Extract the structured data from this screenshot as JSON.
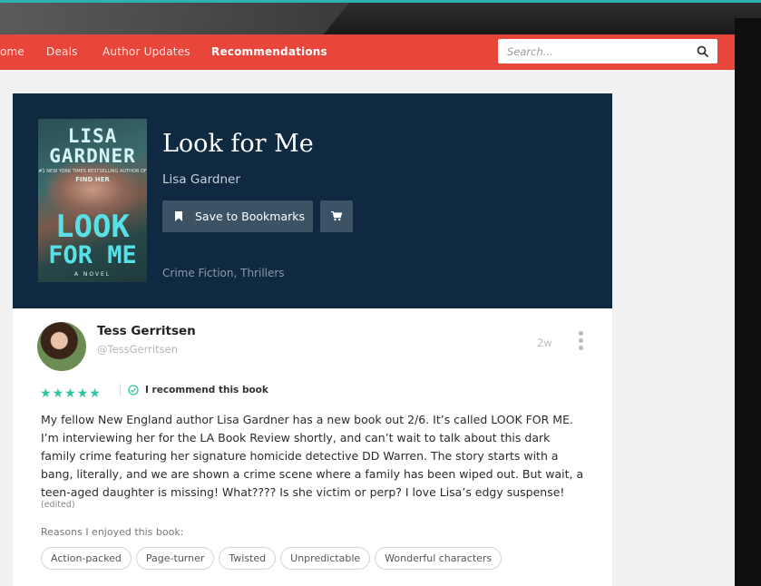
{
  "nav": {
    "items": [
      {
        "label": "ome"
      },
      {
        "label": "Deals"
      },
      {
        "label": "Author Updates"
      },
      {
        "label": "Recommendations",
        "active": true
      }
    ],
    "search_placeholder": "Search..."
  },
  "book": {
    "title": "Look for Me",
    "author": "Lisa Gardner",
    "bookmark_label": "Save to Bookmarks",
    "genres": "Crime Fiction, Thrillers",
    "cover": {
      "author_line1": "LISA",
      "author_line2": "GARDNER",
      "tagline": "#1 NEW YORK TIMES BESTSELLING AUTHOR OF",
      "subtitle": "FIND HER",
      "title_line1": "LOOK",
      "title_line2": "FOR ME",
      "novel": "A NOVEL"
    }
  },
  "review": {
    "reviewer_name": "Tess Gerritsen",
    "reviewer_handle": "@TessGerritsen",
    "time_ago": "2w",
    "rating": 5,
    "recommend_text": "I recommend this book",
    "body": "My fellow New England author Lisa Gardner has a new book out 2/6. It’s called LOOK FOR ME. I’m interviewing her for the LA Book Review shortly, and can’t wait to talk about this dark family crime featuring her signature homicide detective DD Warren. The story starts with a bang, literally, and we are shown a crime scene where a family has been wiped out. But wait, a teen-aged daughter is missing! What???? Is she victim or perp? I love Lisa’s edgy suspense!",
    "edited_label": "(edited)",
    "reasons_label": "Reasons I enjoyed this book:",
    "tags": [
      "Action-packed",
      "Page-turner",
      "Twisted",
      "Unpredictable",
      "Wonderful characters"
    ]
  },
  "colors": {
    "nav_bg": "#e8463a",
    "hero_bg": "#0f2a40",
    "button_bg": "#3b5365",
    "star": "#2ec4a0"
  }
}
